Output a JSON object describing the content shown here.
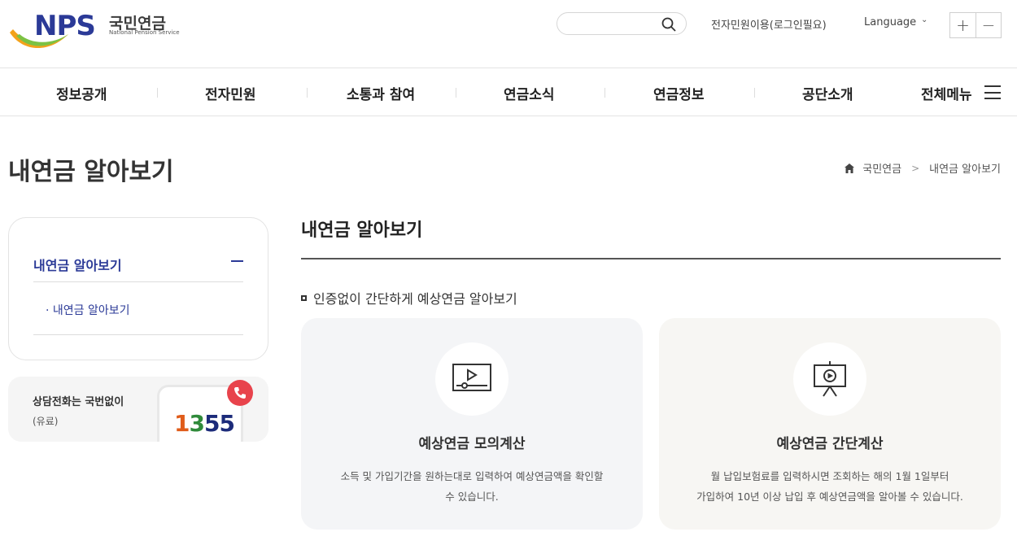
{
  "header": {
    "logo_text": "NPS",
    "logo_kor": "국민연금",
    "logo_eng": "National Pension Service",
    "login_link": "전자민원이용(로그인필요)",
    "language": "Language",
    "zoom_in": "+",
    "zoom_out": "−"
  },
  "gnb": {
    "items": [
      "정보공개",
      "전자민원",
      "소통과 참여",
      "연금소식",
      "연금정보",
      "공단소개"
    ],
    "all_menu": "전체메뉴"
  },
  "page": {
    "title": "내연금 알아보기",
    "breadcrumb": [
      "국민연금",
      "내연금 알아보기"
    ]
  },
  "lnb": {
    "title": "내연금 알아보기",
    "sub_item": "· 내연금 알아보기"
  },
  "call_banner": {
    "text": "상담전화는 국번없이",
    "sub": "(유료)",
    "number": [
      "1",
      "3",
      "55"
    ]
  },
  "content": {
    "title": "내연금 알아보기",
    "section_head": "인증없이 간단하게 예상연금 알아보기",
    "cards": [
      {
        "icon": "video-icon",
        "title": "예상연금 모의계산",
        "desc_line1": "소득 및 가입기간을 원하는대로 입력하여 예상연금액을 확인할",
        "desc_line2": "수 있습니다."
      },
      {
        "icon": "presentation-icon",
        "title": "예상연금 간단계산",
        "desc_line1": "월 납입보험료를 입력하시면 조회하는 해의 1월 1일부터",
        "desc_line2": "가입하여 10년 이상 납입 후 예상연금액을 알아볼 수 있습니다."
      }
    ]
  },
  "colors": {
    "brand": "#2b3a97",
    "accent_red": "#e8434c"
  }
}
